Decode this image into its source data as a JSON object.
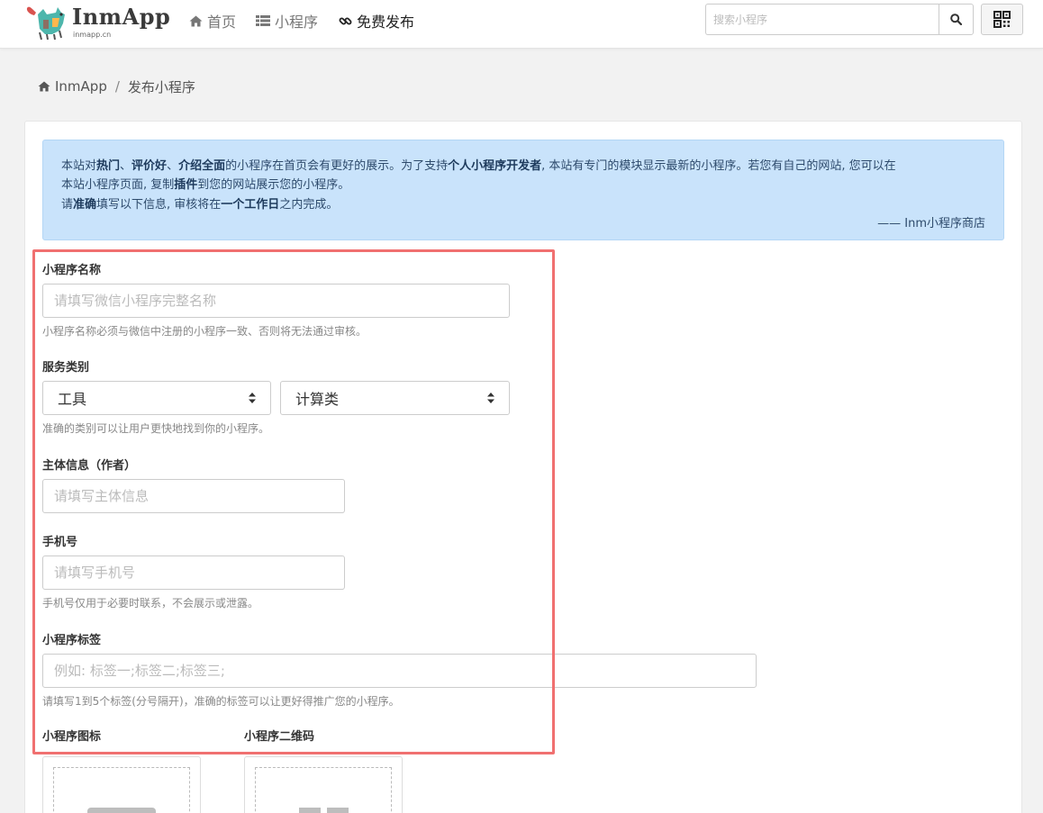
{
  "header": {
    "logo_title": "InmApp",
    "logo_subtitle": "inmapp.cn",
    "nav": [
      {
        "label": "首页",
        "icon": "home-icon"
      },
      {
        "label": "小程序",
        "icon": "list-icon"
      },
      {
        "label": "免费发布",
        "icon": "link-icon"
      }
    ],
    "search": {
      "placeholder": "搜索小程序",
      "value": ""
    }
  },
  "breadcrumb": {
    "home": "InmApp",
    "separator": "/",
    "current": "发布小程序"
  },
  "notice": {
    "line1": [
      {
        "t": "本站对",
        "b": false
      },
      {
        "t": "热门",
        "b": true
      },
      {
        "t": "、",
        "b": false
      },
      {
        "t": "评价好",
        "b": true
      },
      {
        "t": "、",
        "b": false
      },
      {
        "t": "介绍全面",
        "b": true
      },
      {
        "t": "的小程序在首页会有更好的展示。为了支持",
        "b": false
      },
      {
        "t": "个人小程序开发者",
        "b": true
      },
      {
        "t": ", 本站有专门的模块显示最新的小程序。若您有自己的网站, 您可以在",
        "b": false
      }
    ],
    "line2": [
      {
        "t": "本站小程序页面, 复制",
        "b": false
      },
      {
        "t": "插件",
        "b": true
      },
      {
        "t": "到您的网站展示您的小程序。",
        "b": false
      }
    ],
    "line3": [
      {
        "t": "请",
        "b": false
      },
      {
        "t": "准确",
        "b": true
      },
      {
        "t": "填写以下信息, 审核将在",
        "b": false
      },
      {
        "t": "一个工作日",
        "b": true
      },
      {
        "t": "之内完成。",
        "b": false
      }
    ],
    "signature": "—— Inm小程序商店"
  },
  "form": {
    "name": {
      "label": "小程序名称",
      "placeholder": "请填写微信小程序完整名称",
      "value": "",
      "help": "小程序名称必须与微信中注册的小程序一致、否则将无法通过审核。"
    },
    "category": {
      "label": "服务类别",
      "primary": "工具",
      "secondary": "计算类",
      "help": "准确的类别可以让用户更快地找到你的小程序。"
    },
    "author": {
      "label": "主体信息（作者）",
      "placeholder": "请填写主体信息",
      "value": ""
    },
    "phone": {
      "label": "手机号",
      "placeholder": "请填写手机号",
      "value": "",
      "help": "手机号仅用于必要时联系，不会展示或泄露。"
    },
    "tags": {
      "label": "小程序标签",
      "placeholder": "例如: 标签一;标签二;标签三;",
      "value": "",
      "help": "请填写1到5个标签(分号隔开)，准确的标签可以让更好得推广您的小程序。"
    },
    "icon": {
      "label": "小程序图标"
    },
    "qrcode": {
      "label": "小程序二维码"
    }
  },
  "colors": {
    "notice_bg": "#c9e3fb",
    "highlight": "#f07070",
    "page_bg": "#f2f2f2"
  }
}
